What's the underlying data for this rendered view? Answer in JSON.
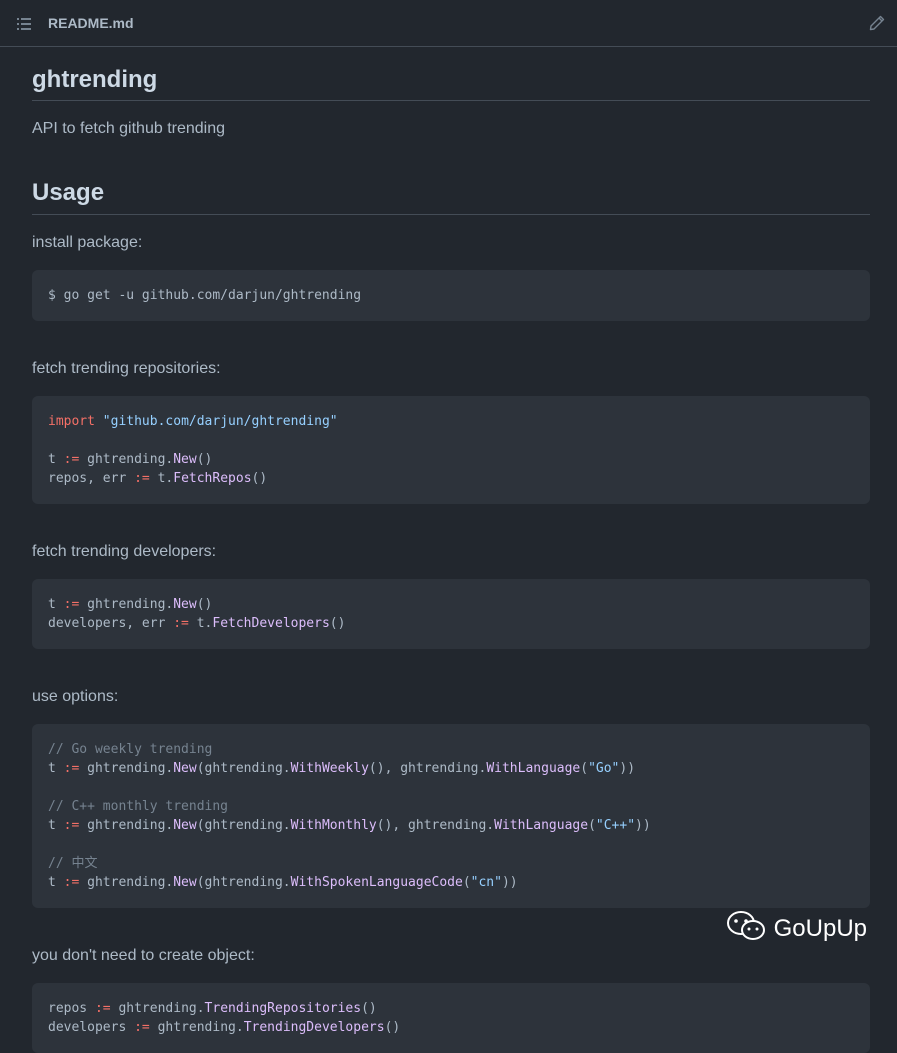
{
  "header": {
    "filename": "README.md",
    "list_icon": "list-unordered-icon",
    "edit_icon": "pencil-icon"
  },
  "readme": {
    "title": "ghtrending",
    "description": "API to fetch github trending",
    "usage_heading": "Usage",
    "install_label": "install package:",
    "install_code": "$ go get -u github.com/darjun/ghtrending",
    "repos_label": "fetch trending repositories:",
    "repos_code": {
      "import_kw": "import",
      "import_path": "\"github.com/darjun/ghtrending\"",
      "line2_var": "t",
      "line2_op": ":=",
      "line2_pkg": "ghtrending.",
      "line2_fn": "New",
      "line2_end": "()",
      "line3_var": "repos, err",
      "line3_op": ":=",
      "line3_obj": "t.",
      "line3_fn": "FetchRepos",
      "line3_end": "()"
    },
    "devs_label": "fetch trending developers:",
    "devs_code": {
      "line1_var": "t",
      "line1_op": ":=",
      "line1_pkg": "ghtrending.",
      "line1_fn": "New",
      "line1_end": "()",
      "line2_var": "developers, err",
      "line2_op": ":=",
      "line2_obj": "t.",
      "line2_fn": "FetchDevelopers",
      "line2_end": "()"
    },
    "options_label": "use options:",
    "options_code": {
      "c1": "// Go weekly trending",
      "c2": "// C++ monthly trending",
      "c3": "// 中文",
      "var": "t",
      "op": ":=",
      "pkg": "ghtrending.",
      "new_fn": "New",
      "open": "(ghtrending.",
      "weekly_fn": "WithWeekly",
      "monthly_fn": "WithMonthly",
      "spoken_fn": "WithSpokenLanguageCode",
      "mid": "(), ghtrending.",
      "lang_fn": "WithLanguage",
      "go_str": "\"Go\"",
      "cpp_str": "\"C++\"",
      "cn_str": "\"cn\"",
      "close2": "))",
      "paren_open": "("
    },
    "noobj_label": "you don't need to create object:",
    "noobj_code": {
      "line1_var": "repos",
      "line1_op": ":=",
      "line1_pkg": "ghtrending.",
      "line1_fn": "TrendingRepositories",
      "line1_end": "()",
      "line2_var": "developers",
      "line2_op": ":=",
      "line2_pkg": "ghtrending.",
      "line2_fn": "TrendingDevelopers",
      "line2_end": "()"
    }
  },
  "watermark": {
    "text": "GoUpUp",
    "icon": "wechat-icon"
  },
  "colors": {
    "background": "#22272e",
    "code_background": "#2d333b",
    "keyword": "#f47067",
    "string": "#96d0ff",
    "function": "#dcbdfb",
    "comment": "#768390"
  }
}
